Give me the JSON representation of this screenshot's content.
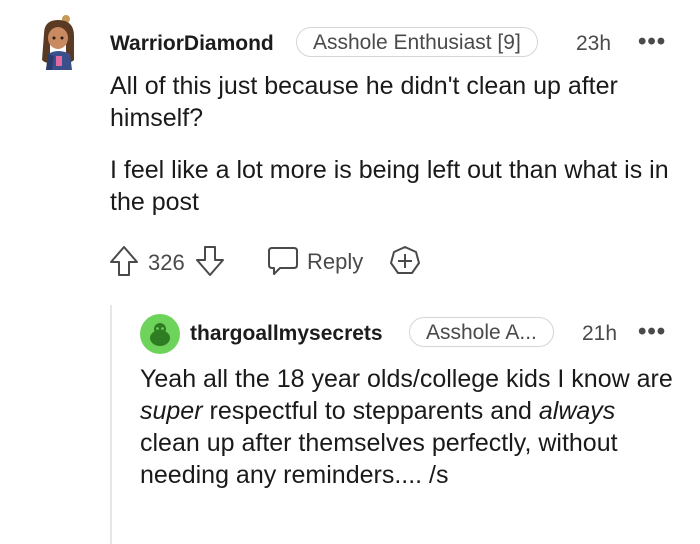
{
  "comment": {
    "username": "WarriorDiamond",
    "flair": "Asshole Enthusiast [9]",
    "time": "23h",
    "more": "•••",
    "paragraphs": [
      "All of this just because he didn't clean up after himself?",
      "I feel like a lot more is being left out than what is in the post"
    ],
    "score": "326",
    "reply_label": "Reply"
  },
  "reply": {
    "username": "thargoallmysecrets",
    "flair": "Asshole A...",
    "time": "21h",
    "more": "•••",
    "text_before_1": "Yeah all the 18 year olds/college kids I know are ",
    "em_1": "super",
    "text_between": " respectful to stepparents and ",
    "em_2": "always",
    "text_after": " clean up after themselves perfectly, without needing any reminders.... /s"
  }
}
